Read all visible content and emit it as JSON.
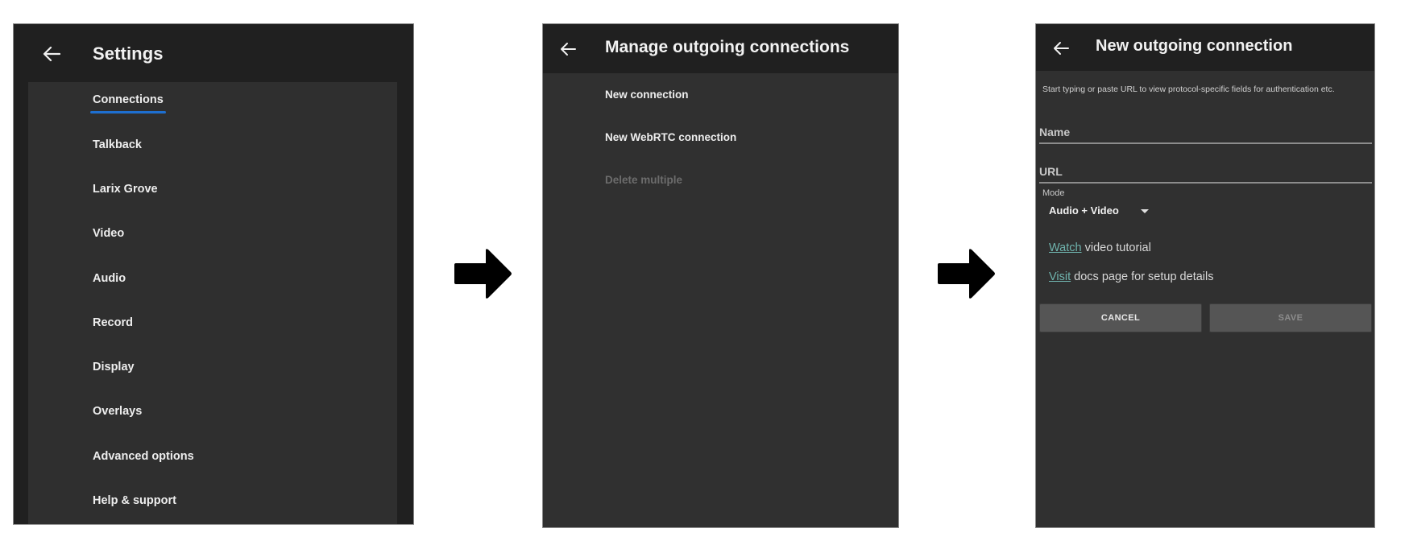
{
  "theme": {
    "accent": "#1e6fd0",
    "link": "#6fb3ad"
  },
  "flow_arrows": [
    "arrow-right",
    "arrow-right"
  ],
  "settings_screen": {
    "back_icon": "arrow-left-icon",
    "title": "Settings",
    "items": [
      {
        "label": "Connections",
        "active": true
      },
      {
        "label": "Talkback"
      },
      {
        "label": "Larix Grove"
      },
      {
        "label": "Video"
      },
      {
        "label": "Audio"
      },
      {
        "label": "Record"
      },
      {
        "label": "Display"
      },
      {
        "label": "Overlays"
      },
      {
        "label": "Advanced options"
      },
      {
        "label": "Help & support"
      }
    ]
  },
  "manage_screen": {
    "back_icon": "arrow-left-icon",
    "title": "Manage outgoing connections",
    "items": [
      {
        "label": "New connection",
        "enabled": true
      },
      {
        "label": "New WebRTC connection",
        "enabled": true
      },
      {
        "label": "Delete multiple",
        "enabled": false
      }
    ]
  },
  "new_connection_screen": {
    "back_icon": "arrow-left-icon",
    "title": "New outgoing connection",
    "hint": "Start typing or paste URL to view protocol-specific fields for authentication etc.",
    "name_field": {
      "placeholder": "Name",
      "value": ""
    },
    "url_field": {
      "placeholder": "URL",
      "value": ""
    },
    "mode": {
      "label": "Mode",
      "selected": "Audio + Video"
    },
    "links": [
      {
        "link_text": "Watch",
        "rest": " video tutorial"
      },
      {
        "link_text": "Visit",
        "rest": " docs page for setup details"
      }
    ],
    "buttons": {
      "cancel": "CANCEL",
      "save": "SAVE",
      "save_enabled": false
    }
  }
}
